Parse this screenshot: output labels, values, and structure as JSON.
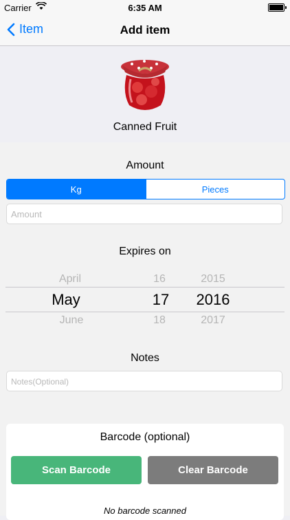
{
  "status_bar": {
    "carrier": "Carrier",
    "time": "6:35 AM"
  },
  "nav": {
    "back_label": "Item",
    "title": "Add item"
  },
  "item": {
    "name": "Canned Fruit",
    "image_icon": "jar-of-canned-fruit"
  },
  "amount": {
    "heading": "Amount",
    "units": [
      "Kg",
      "Pieces"
    ],
    "selected_unit": "Kg",
    "placeholder": "Amount"
  },
  "expires": {
    "heading": "Expires on",
    "months": [
      "April",
      "May",
      "June"
    ],
    "days": [
      "16",
      "17",
      "18"
    ],
    "years": [
      "2015",
      "2016",
      "2017"
    ],
    "selected": {
      "month": "May",
      "day": "17",
      "year": "2016"
    }
  },
  "notes": {
    "heading": "Notes",
    "placeholder": "Notes(Optional)"
  },
  "barcode": {
    "heading": "Barcode (optional)",
    "scan_label": "Scan Barcode",
    "clear_label": "Clear Barcode",
    "status": "No barcode scanned"
  },
  "colors": {
    "accent": "#007aff",
    "scan": "#48b67a",
    "clear": "#7c7c7c"
  }
}
